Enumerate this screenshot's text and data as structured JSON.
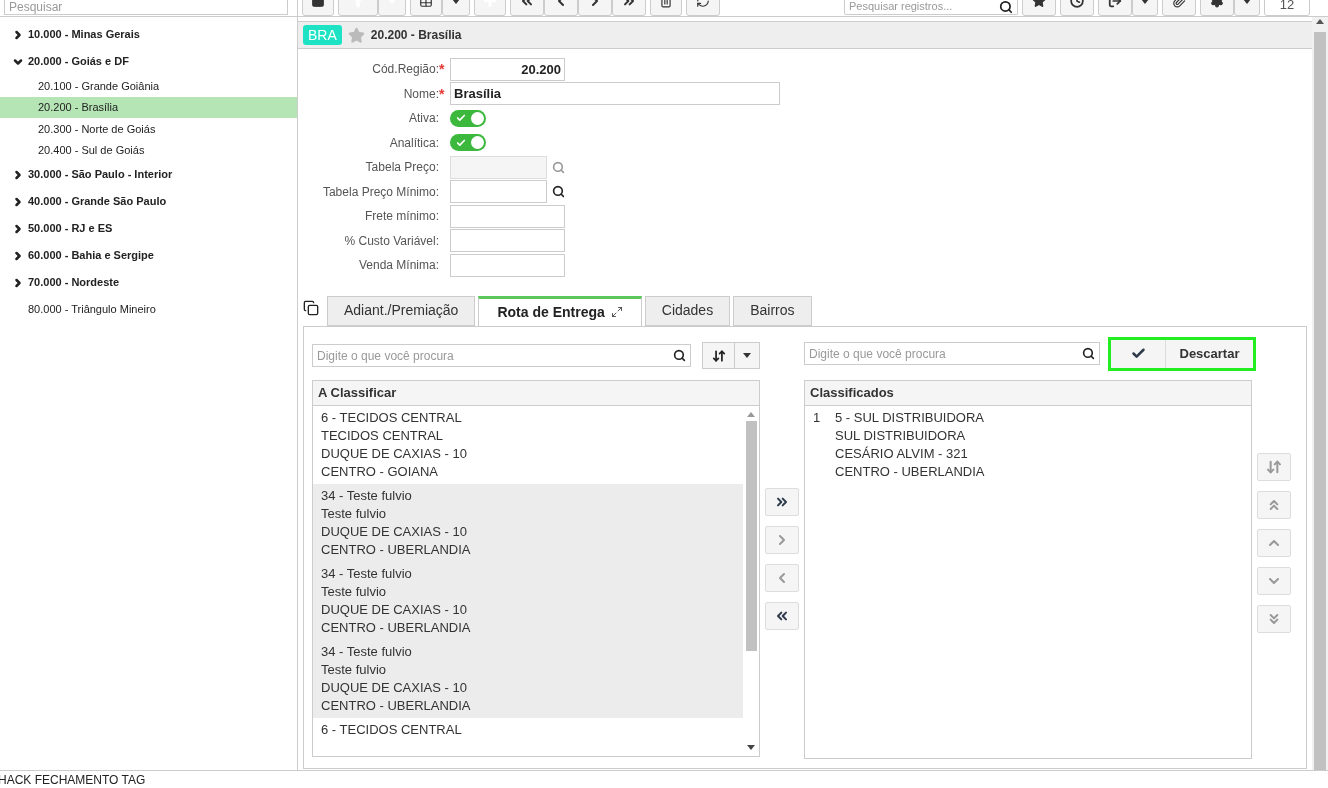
{
  "sidebar": {
    "search": {
      "placeholder": "Pesquisar"
    },
    "tree": [
      {
        "label": "10.000 - Minas Gerais",
        "expanded": false,
        "selected": false
      },
      {
        "label": "20.000 - Goiás e DF",
        "expanded": true,
        "selected": false,
        "children": [
          {
            "label": "20.100 - Grande Goiânia",
            "selected": false
          },
          {
            "label": "20.200 - Brasília",
            "selected": true
          },
          {
            "label": "20.300 - Norte de Goiás",
            "selected": false
          },
          {
            "label": "20.400 - Sul de Goiás",
            "selected": false
          }
        ]
      },
      {
        "label": "30.000 - São Paulo - Interior",
        "expanded": false,
        "selected": false
      },
      {
        "label": "40.000 - Grande São Paulo",
        "expanded": false,
        "selected": false
      },
      {
        "label": "50.000 - RJ e ES",
        "expanded": false,
        "selected": false
      },
      {
        "label": "60.000 - Bahia e Sergipe",
        "expanded": false,
        "selected": false
      },
      {
        "label": "70.000 - Nordeste",
        "expanded": false,
        "selected": false
      },
      {
        "label": "80.000 - Triângulo Mineiro",
        "selected": false
      }
    ]
  },
  "toolbar": {
    "search": {
      "placeholder": "Pesquisar registros..."
    },
    "page_size": "12"
  },
  "header": {
    "badge": "BRA",
    "favorite": false,
    "title": "20.200 - Brasília"
  },
  "form": [
    {
      "kind": "code",
      "label": "Cód.Região:",
      "required_mark": "*",
      "value": "20.200"
    },
    {
      "kind": "name",
      "label": "Nome:",
      "required_mark": "*",
      "value": "Brasília"
    },
    {
      "kind": "toggle",
      "label": "Ativa:",
      "on": true
    },
    {
      "kind": "toggle",
      "label": "Analítica:",
      "on": true
    },
    {
      "kind": "lookup",
      "label": "Tabela Preço:",
      "disabled": true
    },
    {
      "kind": "lookup",
      "label": "Tabela Preço Mínimo:",
      "disabled": false
    },
    {
      "kind": "number",
      "label": "Frete mínimo:"
    },
    {
      "kind": "number",
      "label": "% Custo Variável:"
    },
    {
      "kind": "number",
      "label": "Venda Mínima:"
    }
  ],
  "tabs": [
    {
      "label": "Adiant./Premiação",
      "selected": false
    },
    {
      "label": "Rota de Entrega",
      "selected": true
    },
    {
      "label": "Cidades",
      "selected": false
    },
    {
      "label": "Bairros",
      "selected": false
    }
  ],
  "left_list": {
    "search": {
      "placeholder": "Digite o que você procura"
    },
    "title": "A Classificar",
    "items": [
      {
        "lines": [
          "6 - TECIDOS CENTRAL",
          "TECIDOS CENTRAL",
          "DUQUE DE CAXIAS - 10",
          "CENTRO - GOIANA"
        ],
        "selected": false
      },
      {
        "lines": [
          "34 - Teste fulvio",
          "Teste fulvio",
          "DUQUE DE CAXIAS - 10",
          "CENTRO - UBERLANDIA"
        ],
        "selected": true
      },
      {
        "lines": [
          "34 - Teste fulvio",
          "Teste fulvio",
          "DUQUE DE CAXIAS - 10",
          "CENTRO - UBERLANDIA"
        ],
        "selected": true
      },
      {
        "lines": [
          "34 - Teste fulvio",
          "Teste fulvio",
          "DUQUE DE CAXIAS - 10",
          "CENTRO - UBERLANDIA"
        ],
        "selected": true
      },
      {
        "lines": [
          "6 - TECIDOS CENTRAL"
        ],
        "selected": false
      }
    ]
  },
  "transfer_buttons": [
    {
      "kind": "all-right",
      "disabled": false
    },
    {
      "kind": "right",
      "disabled": true
    },
    {
      "kind": "left",
      "disabled": true
    },
    {
      "kind": "all-left",
      "disabled": false
    }
  ],
  "right_list": {
    "search": {
      "placeholder": "Digite o que você procura"
    },
    "discard": "Descartar",
    "title": "Classificados",
    "items": [
      {
        "index": "1",
        "lines": [
          "5 - SUL DISTRIBUIDORA",
          "SUL DISTRIBUIDORA",
          "CESÁRIO ALVIM - 321",
          "CENTRO - UBERLANDIA"
        ]
      }
    ]
  },
  "order_buttons": [
    {
      "kind": "sort",
      "disabled": true
    },
    {
      "kind": "top",
      "disabled": true
    },
    {
      "kind": "up",
      "disabled": true
    },
    {
      "kind": "down",
      "disabled": true
    },
    {
      "kind": "bottom",
      "disabled": true
    }
  ],
  "status_bar": "HACK FECHAMENTO TAG"
}
